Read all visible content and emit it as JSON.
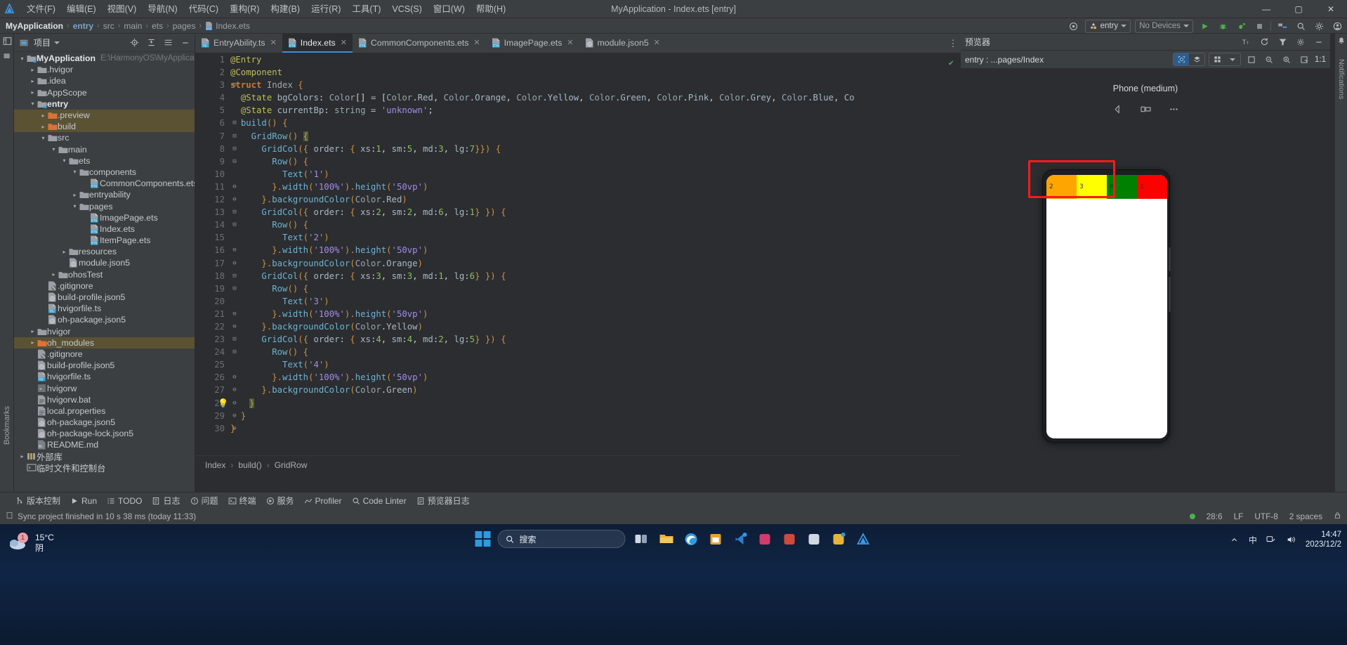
{
  "titlebar": {
    "app_icon": "harmony-logo-icon",
    "menus": [
      "文件(F)",
      "编辑(E)",
      "视图(V)",
      "导航(N)",
      "代码(C)",
      "重构(R)",
      "构建(B)",
      "运行(R)",
      "工具(T)",
      "VCS(S)",
      "窗口(W)",
      "帮助(H)"
    ],
    "window_title": "MyApplication - Index.ets [entry]",
    "minimize": "—",
    "maximize": "▢",
    "close": "✕"
  },
  "breadcrumb": {
    "items": [
      "MyApplication",
      "entry",
      "src",
      "main",
      "ets",
      "pages",
      "Index.ets"
    ],
    "separator": "›"
  },
  "main_toolbar": {
    "target_icon": "target-icon",
    "run_config": "entry",
    "device_selector": "No Devices",
    "run": "run-icon",
    "debug": "debug-icon",
    "profile": "debug-attach-icon",
    "stop": "stop-icon",
    "device_manager": "device-manager-icon",
    "search": "search-icon",
    "settings": "gear-icon",
    "account": "account-icon"
  },
  "left_strip": {
    "labels": [
      "Bookmarks"
    ]
  },
  "project_panel": {
    "header_title": "项目",
    "header_icons": [
      "locate-icon",
      "collapse-all-icon",
      "settings-icon",
      "hide-icon"
    ],
    "tree": [
      {
        "depth": 0,
        "arrow": "v",
        "icon": "module-folder",
        "label": "MyApplication",
        "bold": true,
        "hint": "E:\\HarmonyOS\\MyApplication",
        "selected": false
      },
      {
        "depth": 1,
        "arrow": ">",
        "icon": "folder",
        "label": ".hvigor",
        "bold": false,
        "hint": "",
        "selected": false
      },
      {
        "depth": 1,
        "arrow": ">",
        "icon": "folder",
        "label": ".idea",
        "bold": false,
        "hint": "",
        "selected": false
      },
      {
        "depth": 1,
        "arrow": ">",
        "icon": "folder",
        "label": "AppScope",
        "bold": false,
        "hint": "",
        "selected": false
      },
      {
        "depth": 1,
        "arrow": "v",
        "icon": "module-folder",
        "label": "entry",
        "bold": true,
        "hint": "",
        "selected": false
      },
      {
        "depth": 2,
        "arrow": ">",
        "icon": "folder-orange",
        "label": ".preview",
        "bold": false,
        "hint": "",
        "selected": true
      },
      {
        "depth": 2,
        "arrow": ">",
        "icon": "folder-orange",
        "label": "build",
        "bold": false,
        "hint": "",
        "selected": true
      },
      {
        "depth": 2,
        "arrow": "v",
        "icon": "folder",
        "label": "src",
        "bold": false,
        "hint": "",
        "selected": false
      },
      {
        "depth": 3,
        "arrow": "v",
        "icon": "folder",
        "label": "main",
        "bold": false,
        "hint": "",
        "selected": false
      },
      {
        "depth": 4,
        "arrow": "v",
        "icon": "folder",
        "label": "ets",
        "bold": false,
        "hint": "",
        "selected": false
      },
      {
        "depth": 5,
        "arrow": "v",
        "icon": "folder",
        "label": "components",
        "bold": false,
        "hint": "",
        "selected": false
      },
      {
        "depth": 6,
        "arrow": "",
        "icon": "ets-file",
        "label": "CommonComponents.ets",
        "bold": false,
        "hint": "",
        "selected": false
      },
      {
        "depth": 5,
        "arrow": ">",
        "icon": "folder",
        "label": "entryability",
        "bold": false,
        "hint": "",
        "selected": false
      },
      {
        "depth": 5,
        "arrow": "v",
        "icon": "folder",
        "label": "pages",
        "bold": false,
        "hint": "",
        "selected": false
      },
      {
        "depth": 6,
        "arrow": "",
        "icon": "ets-file",
        "label": "ImagePage.ets",
        "bold": false,
        "hint": "",
        "selected": false
      },
      {
        "depth": 6,
        "arrow": "",
        "icon": "ets-file",
        "label": "Index.ets",
        "bold": false,
        "hint": "",
        "selected": false
      },
      {
        "depth": 6,
        "arrow": "",
        "icon": "ets-file",
        "label": "ItemPage.ets",
        "bold": false,
        "hint": "",
        "selected": false
      },
      {
        "depth": 4,
        "arrow": ">",
        "icon": "folder",
        "label": "resources",
        "bold": false,
        "hint": "",
        "selected": false
      },
      {
        "depth": 4,
        "arrow": "",
        "icon": "json5-file",
        "label": "module.json5",
        "bold": false,
        "hint": "",
        "selected": false
      },
      {
        "depth": 3,
        "arrow": ">",
        "icon": "folder",
        "label": "ohosTest",
        "bold": false,
        "hint": "",
        "selected": false
      },
      {
        "depth": 2,
        "arrow": "",
        "icon": "gitignore-file",
        "label": ".gitignore",
        "bold": false,
        "hint": "",
        "selected": false
      },
      {
        "depth": 2,
        "arrow": "",
        "icon": "json5-file",
        "label": "build-profile.json5",
        "bold": false,
        "hint": "",
        "selected": false
      },
      {
        "depth": 2,
        "arrow": "",
        "icon": "ts-file",
        "label": "hvigorfile.ts",
        "bold": false,
        "hint": "",
        "selected": false
      },
      {
        "depth": 2,
        "arrow": "",
        "icon": "json5-file",
        "label": "oh-package.json5",
        "bold": false,
        "hint": "",
        "selected": false
      },
      {
        "depth": 1,
        "arrow": ">",
        "icon": "folder",
        "label": "hvigor",
        "bold": false,
        "hint": "",
        "selected": false
      },
      {
        "depth": 1,
        "arrow": ">",
        "icon": "folder-orange",
        "label": "oh_modules",
        "bold": false,
        "hint": "",
        "selected": true
      },
      {
        "depth": 1,
        "arrow": "",
        "icon": "gitignore-file",
        "label": ".gitignore",
        "bold": false,
        "hint": "",
        "selected": false
      },
      {
        "depth": 1,
        "arrow": "",
        "icon": "json5-file",
        "label": "build-profile.json5",
        "bold": false,
        "hint": "",
        "selected": false
      },
      {
        "depth": 1,
        "arrow": "",
        "icon": "ts-file",
        "label": "hvigorfile.ts",
        "bold": false,
        "hint": "",
        "selected": false
      },
      {
        "depth": 1,
        "arrow": "",
        "icon": "exec-file",
        "label": "hvigorw",
        "bold": false,
        "hint": "",
        "selected": false
      },
      {
        "depth": 1,
        "arrow": "",
        "icon": "bat-file",
        "label": "hvigorw.bat",
        "bold": false,
        "hint": "",
        "selected": false
      },
      {
        "depth": 1,
        "arrow": "",
        "icon": "props-file",
        "label": "local.properties",
        "bold": false,
        "hint": "",
        "selected": false
      },
      {
        "depth": 1,
        "arrow": "",
        "icon": "json5-file",
        "label": "oh-package.json5",
        "bold": false,
        "hint": "",
        "selected": false
      },
      {
        "depth": 1,
        "arrow": "",
        "icon": "json5-file",
        "label": "oh-package-lock.json5",
        "bold": false,
        "hint": "",
        "selected": false
      },
      {
        "depth": 1,
        "arrow": "",
        "icon": "md-file",
        "label": "README.md",
        "bold": false,
        "hint": "",
        "selected": false
      },
      {
        "depth": 0,
        "arrow": ">",
        "icon": "library-icon",
        "label": "外部库",
        "bold": false,
        "hint": "",
        "selected": false
      },
      {
        "depth": 0,
        "arrow": "",
        "icon": "console-icon",
        "label": "临时文件和控制台",
        "bold": false,
        "hint": "",
        "selected": false
      }
    ]
  },
  "editor": {
    "tabs": [
      {
        "label": "EntryAbility.ts",
        "icon": "ts-file",
        "active": false,
        "closable": true
      },
      {
        "label": "Index.ets",
        "icon": "ets-file",
        "active": true,
        "closable": true
      },
      {
        "label": "CommonComponents.ets",
        "icon": "ets-file",
        "active": false,
        "closable": true
      },
      {
        "label": "ImagePage.ets",
        "icon": "ets-file",
        "active": false,
        "closable": true
      },
      {
        "label": "module.json5",
        "icon": "json5-file",
        "active": false,
        "closable": true
      }
    ],
    "tab_overflow_icon": "more-vertical-icon",
    "inspection_status": "✔",
    "lines": [
      {
        "n": 1,
        "fold": "",
        "code": "@Entry"
      },
      {
        "n": 2,
        "fold": "",
        "code": "@Component"
      },
      {
        "n": 3,
        "fold": "⊟",
        "code": "struct Index {"
      },
      {
        "n": 4,
        "fold": "",
        "code": "  @State bgColors: Color[] = [Color.Red, Color.Orange, Color.Yellow, Color.Green, Color.Pink, Color.Grey, Color.Blue, Co"
      },
      {
        "n": 5,
        "fold": "",
        "code": "  @State currentBp: string = 'unknown';"
      },
      {
        "n": 6,
        "fold": "⊟",
        "code": "  build() {"
      },
      {
        "n": 7,
        "fold": "⊟",
        "code": "    GridRow() {"
      },
      {
        "n": 8,
        "fold": "⊟",
        "code": "      GridCol({ order: { xs:1, sm:5, md:3, lg:7}}) {"
      },
      {
        "n": 9,
        "fold": "⊟",
        "code": "        Row() {"
      },
      {
        "n": 10,
        "fold": "",
        "code": "          Text('1')"
      },
      {
        "n": 11,
        "fold": "⊖",
        "code": "        }.width('100%').height('50vp')"
      },
      {
        "n": 12,
        "fold": "⊖",
        "code": "      }.backgroundColor(Color.Red)"
      },
      {
        "n": 13,
        "fold": "⊟",
        "code": "      GridCol({ order: { xs:2, sm:2, md:6, lg:1} }) {"
      },
      {
        "n": 14,
        "fold": "⊟",
        "code": "        Row() {"
      },
      {
        "n": 15,
        "fold": "",
        "code": "          Text('2')"
      },
      {
        "n": 16,
        "fold": "⊖",
        "code": "        }.width('100%').height('50vp')"
      },
      {
        "n": 17,
        "fold": "⊖",
        "code": "      }.backgroundColor(Color.Orange)"
      },
      {
        "n": 18,
        "fold": "⊟",
        "code": "      GridCol({ order: { xs:3, sm:3, md:1, lg:6} }) {"
      },
      {
        "n": 19,
        "fold": "⊟",
        "code": "        Row() {"
      },
      {
        "n": 20,
        "fold": "",
        "code": "          Text('3')"
      },
      {
        "n": 21,
        "fold": "⊖",
        "code": "        }.width('100%').height('50vp')"
      },
      {
        "n": 22,
        "fold": "⊖",
        "code": "      }.backgroundColor(Color.Yellow)"
      },
      {
        "n": 23,
        "fold": "⊟",
        "code": "      GridCol({ order: { xs:4, sm:4, md:2, lg:5} }) {"
      },
      {
        "n": 24,
        "fold": "⊟",
        "code": "        Row() {"
      },
      {
        "n": 25,
        "fold": "",
        "code": "          Text('4')"
      },
      {
        "n": 26,
        "fold": "⊖",
        "code": "        }.width('100%').height('50vp')"
      },
      {
        "n": 27,
        "fold": "⊖",
        "code": "      }.backgroundColor(Color.Green)"
      },
      {
        "n": 28,
        "fold": "⊖",
        "code": "    }"
      },
      {
        "n": 29,
        "fold": "⊖",
        "code": "  }"
      },
      {
        "n": 30,
        "fold": "⊖",
        "code": "}"
      }
    ],
    "bottom_breadcrumb": [
      "Index",
      "build()",
      "GridRow"
    ]
  },
  "preview": {
    "panel_title": "预览器",
    "header_icons": [
      "text-size-icon",
      "refresh-icon",
      "filter-icon",
      "gear-icon",
      "minimize-icon"
    ],
    "path_label": "entry : ...pages/Index",
    "toolbar_icons": [
      "inspector-icon",
      "layers-icon",
      "multi-device-icon",
      "chevron-down-icon",
      "fit-icon",
      "zoom-out-icon",
      "zoom-in-icon",
      "actual-size-icon"
    ],
    "zoom_level": "1:1",
    "device_label": "Phone (medium)",
    "device_controls": [
      "back-icon",
      "rotate-icon",
      "more-icon"
    ],
    "blocks": [
      {
        "label": "2",
        "color": "#FFA500"
      },
      {
        "label": "3",
        "color": "#FFFF00"
      },
      {
        "label": "4",
        "color": "#008000"
      },
      {
        "label": "1",
        "color": "#FF0000"
      }
    ]
  },
  "right_strip": {
    "label": "Notifications"
  },
  "bottom_tools": [
    {
      "icon": "vcs-icon",
      "label": "版本控制"
    },
    {
      "icon": "run-icon",
      "label": "Run"
    },
    {
      "icon": "todo-icon",
      "label": "TODO"
    },
    {
      "icon": "log-icon",
      "label": "日志"
    },
    {
      "icon": "problems-icon",
      "label": "问题"
    },
    {
      "icon": "terminal-icon",
      "label": "终端"
    },
    {
      "icon": "services-icon",
      "label": "服务"
    },
    {
      "icon": "profiler-icon",
      "label": "Profiler"
    },
    {
      "icon": "code-linter-icon",
      "label": "Code Linter"
    },
    {
      "icon": "preview-log-icon",
      "label": "预览器日志"
    }
  ],
  "statusbar": {
    "message": "Sync project finished in 10 s 38 ms (today 11:33)",
    "caret_position": "28:6",
    "line_separator": "LF",
    "encoding": "UTF-8",
    "indent": "2 spaces",
    "lock_icon": "lock-icon"
  },
  "taskbar": {
    "weather_temp": "15°C",
    "weather_desc": "阴",
    "weather_badge": "1",
    "search_placeholder": "搜索",
    "search_icon": "search-icon",
    "start_icon": "windows-start-icon",
    "pinned": [
      "task-view-icon",
      "file-explorer-icon",
      "edge-icon",
      "store-icon",
      "vscode-icon",
      "devtool-icon",
      "pdf-icon",
      "terminal-icon",
      "chrome-icon",
      "harmony-icon"
    ],
    "tray_icons": [
      "chevron-up-icon",
      "ime-icon",
      "network-icon",
      "volume-icon"
    ],
    "ime_label": "中",
    "clock_time": "14:47",
    "clock_date": "2023/12/2"
  }
}
